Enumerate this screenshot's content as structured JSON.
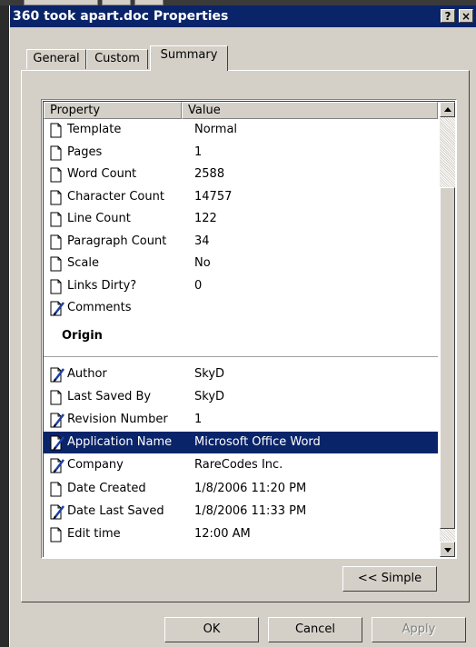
{
  "window": {
    "title": "360 took apart.doc Properties",
    "help_label": "?",
    "close_label": "×"
  },
  "tabs": [
    {
      "label": "General"
    },
    {
      "label": "Custom"
    },
    {
      "label": "Summary",
      "active": true
    }
  ],
  "list": {
    "columns": [
      "Property",
      "Value"
    ],
    "rows": [
      {
        "name": "Template",
        "value": "Normal",
        "icon": "document-icon"
      },
      {
        "name": "Pages",
        "value": "1",
        "icon": "document-icon"
      },
      {
        "name": "Word Count",
        "value": "2588",
        "icon": "document-icon"
      },
      {
        "name": "Character Count",
        "value": "14757",
        "icon": "document-icon"
      },
      {
        "name": "Line Count",
        "value": "122",
        "icon": "document-icon"
      },
      {
        "name": "Paragraph Count",
        "value": "34",
        "icon": "document-icon"
      },
      {
        "name": "Scale",
        "value": "No",
        "icon": "document-icon"
      },
      {
        "name": "Links Dirty?",
        "value": "0",
        "icon": "document-icon"
      },
      {
        "name": "Comments",
        "value": "",
        "icon": "editable-document-icon"
      }
    ],
    "group_origin": "Origin",
    "origin_rows": [
      {
        "name": "Author",
        "value": "SkyD",
        "icon": "editable-document-icon"
      },
      {
        "name": "Last Saved By",
        "value": "SkyD",
        "icon": "document-icon"
      },
      {
        "name": "Revision Number",
        "value": "1",
        "icon": "editable-document-icon"
      },
      {
        "name": "Application Name",
        "value": "Microsoft Office Word",
        "icon": "editable-document-icon",
        "selected": true
      },
      {
        "name": "Company",
        "value": "RareCodes Inc.",
        "icon": "editable-document-icon"
      },
      {
        "name": "Date Created",
        "value": "1/8/2006 11:20 PM",
        "icon": "document-icon"
      },
      {
        "name": "Date Last Saved",
        "value": "1/8/2006 11:33 PM",
        "icon": "editable-document-icon"
      },
      {
        "name": "Edit time",
        "value": " 12:00 AM",
        "icon": "document-icon"
      }
    ]
  },
  "buttons": {
    "simple": "<< Simple",
    "ok": "OK",
    "cancel": "Cancel",
    "apply": "Apply"
  },
  "colors": {
    "title_bar": "#0a246a",
    "dialog": "#d4d0c8",
    "selection": "#0a246a"
  }
}
